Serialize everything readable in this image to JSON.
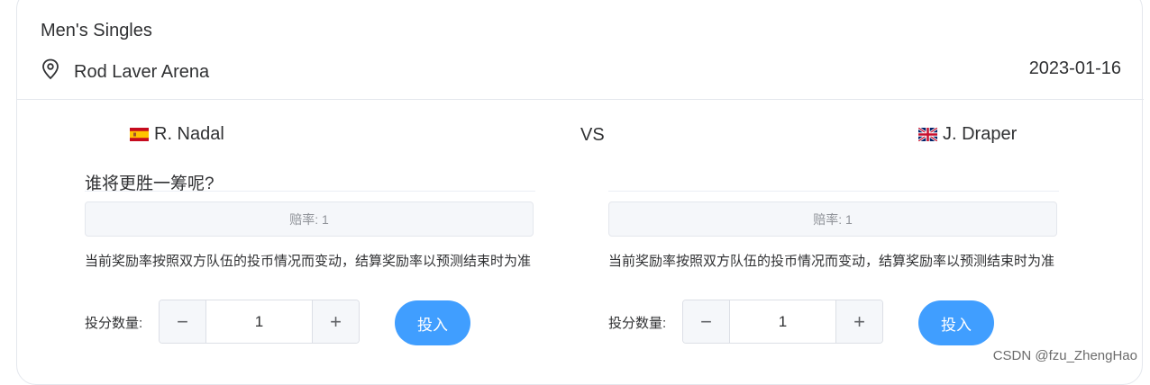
{
  "event": {
    "title": "Men's Singles",
    "venue": "Rod Laver Arena",
    "date": "2023-01-16",
    "pin_icon": "location-pin-icon"
  },
  "players": {
    "left": {
      "name": "R. Nadal",
      "flag": "spain-flag-icon"
    },
    "vs": "VS",
    "right": {
      "name": "J. Draper",
      "flag": "uk-flag-icon"
    }
  },
  "question": "谁将更胜一筹呢?",
  "left_panel": {
    "odds": "赔率: 1",
    "note": "当前奖励率按照双方队伍的投币情况而变动，结算奖励率以预测结束时为准",
    "qty_label": "投分数量:",
    "qty_value": "1",
    "bet_label": "投入"
  },
  "right_panel": {
    "odds": "赔率: 1",
    "note": "当前奖励率按照双方队伍的投币情况而变动，结算奖励率以预测结束时为准",
    "qty_label": "投分数量:",
    "qty_value": "1",
    "bet_label": "投入"
  },
  "stepper_symbols": {
    "minus": "−",
    "plus": "+"
  },
  "watermark": "CSDN @fzu_ZhengHao",
  "colors": {
    "primary": "#409eff",
    "border": "#e4e7ed",
    "muted": "#909399"
  }
}
